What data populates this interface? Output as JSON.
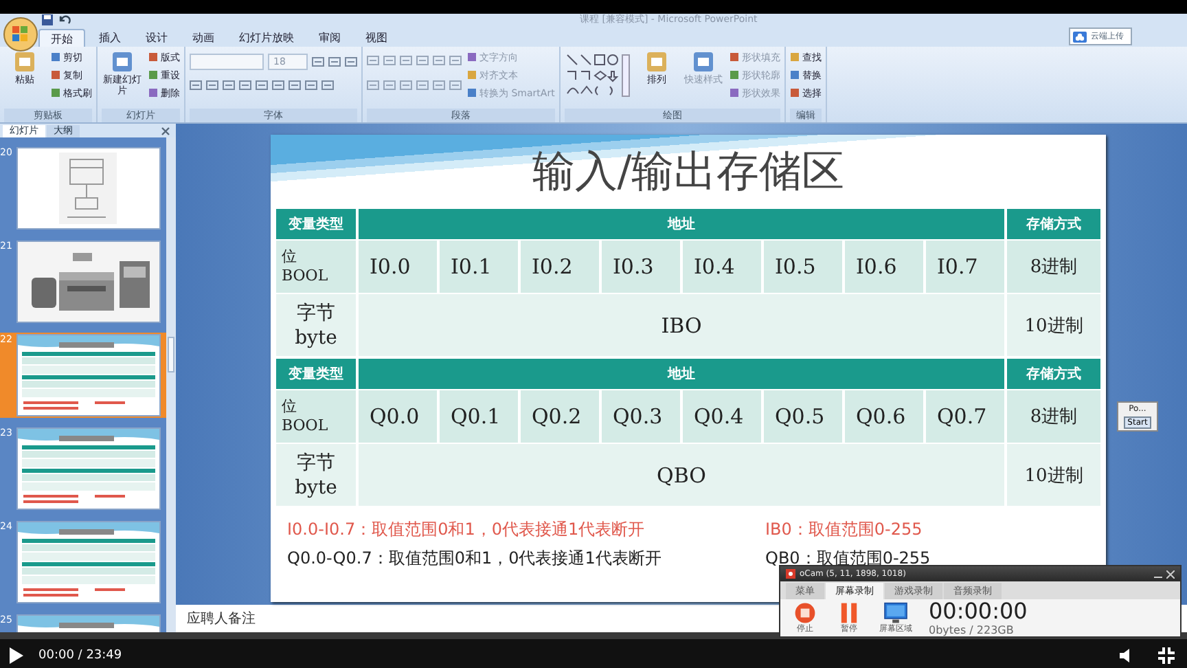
{
  "window": {
    "title": "课程 [兼容模式] - Microsoft PowerPoint"
  },
  "ribbon": {
    "tabs": [
      {
        "label": "开始",
        "selected": true
      },
      {
        "label": "插入",
        "selected": false
      },
      {
        "label": "设计",
        "selected": false
      },
      {
        "label": "动画",
        "selected": false
      },
      {
        "label": "幻灯片放映",
        "selected": false
      },
      {
        "label": "审阅",
        "selected": false
      },
      {
        "label": "视图",
        "selected": false
      }
    ],
    "cloud_button": "云端上传",
    "groups": [
      {
        "label": "剪贴板",
        "items": [
          {
            "kind": "large",
            "label": "粘贴",
            "disabled": false
          },
          {
            "kind": "small",
            "label": "剪切",
            "disabled": false
          },
          {
            "kind": "small",
            "label": "复制",
            "disabled": false
          },
          {
            "kind": "small",
            "label": "格式刷",
            "disabled": false
          }
        ]
      },
      {
        "label": "幻灯片",
        "items": [
          {
            "kind": "large",
            "label": "新建幻灯片",
            "disabled": false
          },
          {
            "kind": "small",
            "label": "版式",
            "disabled": false
          },
          {
            "kind": "small",
            "label": "重设",
            "disabled": false
          },
          {
            "kind": "small",
            "label": "删除",
            "disabled": false
          }
        ]
      },
      {
        "label": "字体",
        "items": [
          {
            "kind": "font",
            "label": "18",
            "disabled": true
          }
        ]
      },
      {
        "label": "段落",
        "items": [
          {
            "kind": "paragraph",
            "disabled": true
          },
          {
            "kind": "small",
            "label": "文字方向",
            "disabled": true
          },
          {
            "kind": "small",
            "label": "对齐文本",
            "disabled": true
          },
          {
            "kind": "small",
            "label": "转换为 SmartArt",
            "disabled": true
          }
        ]
      },
      {
        "label": "绘图",
        "items": [
          {
            "kind": "shapes",
            "disabled": false
          },
          {
            "kind": "large",
            "label": "排列",
            "disabled": false
          },
          {
            "kind": "large",
            "label": "快速样式",
            "disabled": true
          },
          {
            "kind": "small",
            "label": "形状填充",
            "disabled": true
          },
          {
            "kind": "small",
            "label": "形状轮廓",
            "disabled": true
          },
          {
            "kind": "small",
            "label": "形状效果",
            "disabled": true
          }
        ]
      },
      {
        "label": "编辑",
        "items": [
          {
            "kind": "small",
            "label": "查找",
            "disabled": false
          },
          {
            "kind": "small",
            "label": "替换",
            "disabled": false
          },
          {
            "kind": "small",
            "label": "选择",
            "disabled": false
          }
        ]
      }
    ]
  },
  "slides_panel": {
    "tabs": [
      {
        "label": "幻灯片",
        "selected": true
      },
      {
        "label": "大纲",
        "selected": false
      }
    ],
    "slides": [
      {
        "number": "20",
        "kind": "figure",
        "selected": false
      },
      {
        "number": "21",
        "kind": "picture",
        "selected": false
      },
      {
        "number": "22",
        "kind": "table",
        "selected": true
      },
      {
        "number": "23",
        "kind": "table",
        "selected": false
      },
      {
        "number": "24",
        "kind": "table",
        "selected": false
      },
      {
        "number": "25",
        "kind": "table",
        "selected": false
      }
    ]
  },
  "slide": {
    "title": "输入/输出存储区",
    "tables": [
      {
        "header": [
          "变量类型",
          "地址",
          "存储方式"
        ],
        "bit_row": {
          "type": "位",
          "type_en": "BOOL",
          "cells": [
            "I0.0",
            "I0.1",
            "I0.2",
            "I0.3",
            "I0.4",
            "I0.5",
            "I0.6",
            "I0.7"
          ],
          "storage": "8进制"
        },
        "byte_row": {
          "type": "字节",
          "type_en": "byte",
          "value": "IBO",
          "storage": "10进制"
        }
      },
      {
        "header": [
          "变量类型",
          "地址",
          "存储方式"
        ],
        "bit_row": {
          "type": "位",
          "type_en": "BOOL",
          "cells": [
            "Q0.0",
            "Q0.1",
            "Q0.2",
            "Q0.3",
            "Q0.4",
            "Q0.5",
            "Q0.6",
            "Q0.7"
          ],
          "storage": "8进制"
        },
        "byte_row": {
          "type": "字节",
          "type_en": "byte",
          "value": "QBO",
          "storage": "10进制"
        }
      }
    ],
    "notes": [
      {
        "text": "I0.0-I0.7：取值范围0和1，0代表接通1代表断开",
        "color": "#e0584c"
      },
      {
        "text": "IB0：取值范围0-255",
        "color": "#e0584c"
      },
      {
        "text": "Q0.0-Q0.7：取值范围0和1，0代表接通1代表断开",
        "color": "#222222"
      },
      {
        "text": "QB0：取值范围0-255",
        "color": "#222222"
      }
    ]
  },
  "notes_pane": {
    "text": "应聘人备注"
  },
  "floating_window": {
    "title": "Po...",
    "button": "Start"
  },
  "recorder": {
    "title": "oCam (5, 11, 1898, 1018)",
    "tabs": [
      {
        "label": "菜单",
        "selected": false
      },
      {
        "label": "屏幕录制",
        "selected": true
      },
      {
        "label": "游戏录制",
        "selected": false
      },
      {
        "label": "音频录制",
        "selected": false
      }
    ],
    "buttons": [
      {
        "kind": "stop",
        "label": "停止"
      },
      {
        "kind": "pause",
        "label": "暂停"
      },
      {
        "kind": "area",
        "label": "屏幕区域"
      }
    ],
    "time": "00:00:00",
    "size": "0bytes / 223GB"
  },
  "player": {
    "time": "00:00 / 23:49"
  }
}
